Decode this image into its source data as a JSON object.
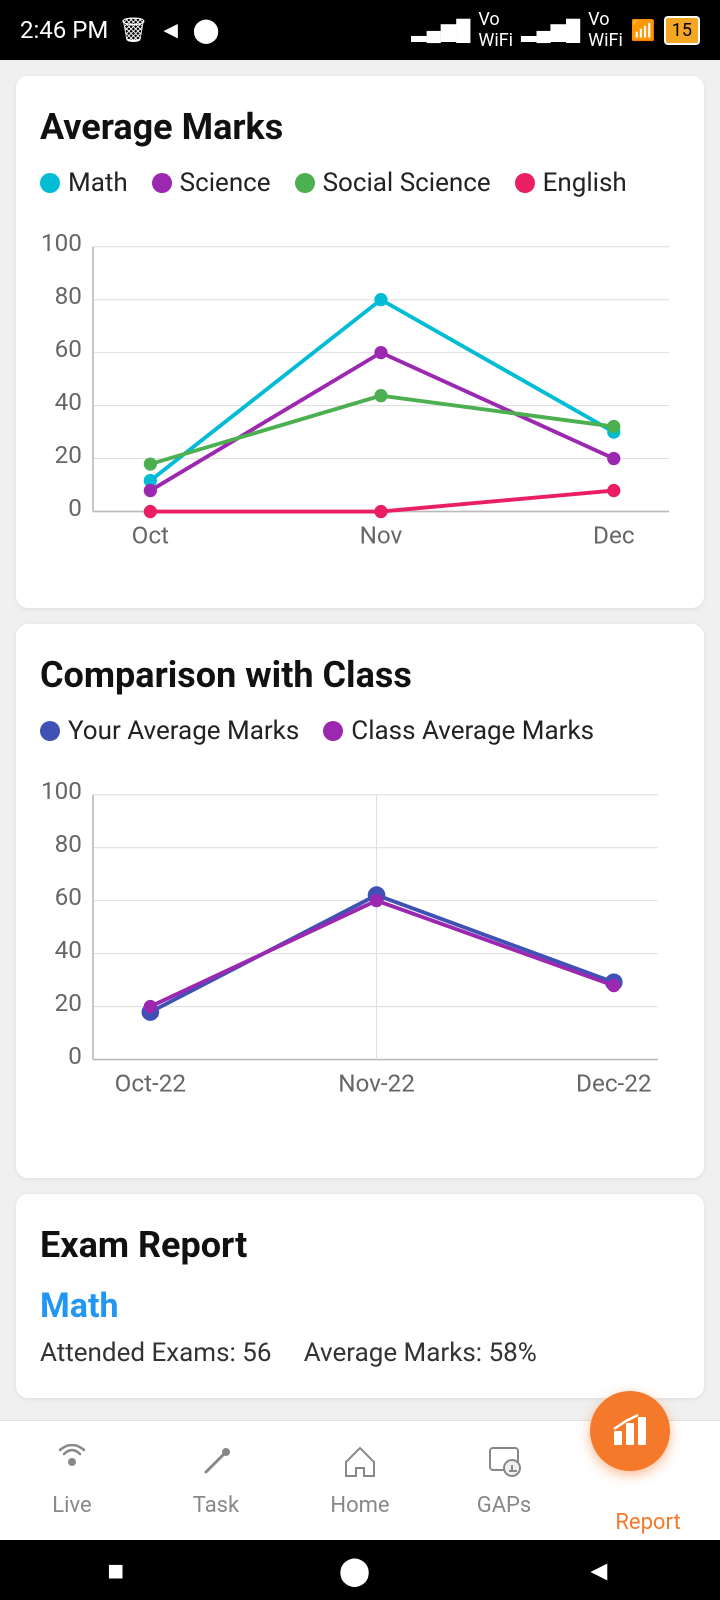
{
  "statusBar": {
    "time": "2:46 PM",
    "battery": "15"
  },
  "avgMarksCard": {
    "title": "Average Marks",
    "legend": [
      {
        "label": "Math",
        "color": "#00BCD4"
      },
      {
        "label": "Science",
        "color": "#9C27B0"
      },
      {
        "label": "Social Science",
        "color": "#4CAF50"
      },
      {
        "label": "English",
        "color": "#E91E63"
      }
    ],
    "xLabels": [
      "Oct",
      "Nov",
      "Dec"
    ],
    "yLabels": [
      "0",
      "20",
      "40",
      "60",
      "80",
      "100"
    ],
    "series": {
      "math": [
        14,
        80,
        30
      ],
      "science": [
        8,
        60,
        20
      ],
      "socialScience": [
        18,
        44,
        32
      ],
      "english": [
        0,
        0,
        8
      ]
    }
  },
  "comparisonCard": {
    "title": "Comparison with Class",
    "legend": [
      {
        "label": "Your Average Marks",
        "color": "#3F51B5"
      },
      {
        "label": "Class Average Marks",
        "color": "#9C27B0"
      }
    ],
    "xLabels": [
      "Oct-22",
      "Nov-22",
      "Dec-22"
    ],
    "yLabels": [
      "0",
      "20",
      "40",
      "60",
      "80",
      "100"
    ],
    "series": {
      "yourAvg": [
        18,
        62,
        29
      ],
      "classAvg": [
        20,
        60,
        28
      ]
    }
  },
  "examReport": {
    "title": "Exam Report",
    "subject": "Math",
    "attendedExams": "56",
    "averageMarks": "58%"
  },
  "bottomNav": {
    "items": [
      {
        "label": "Live",
        "icon": "📡",
        "active": false
      },
      {
        "label": "Task",
        "icon": "✏️",
        "active": false
      },
      {
        "label": "Home",
        "icon": "🏠",
        "active": false
      },
      {
        "label": "GAPs",
        "icon": "🔍",
        "active": false
      },
      {
        "label": "Report",
        "icon": "📊",
        "active": true
      }
    ]
  }
}
